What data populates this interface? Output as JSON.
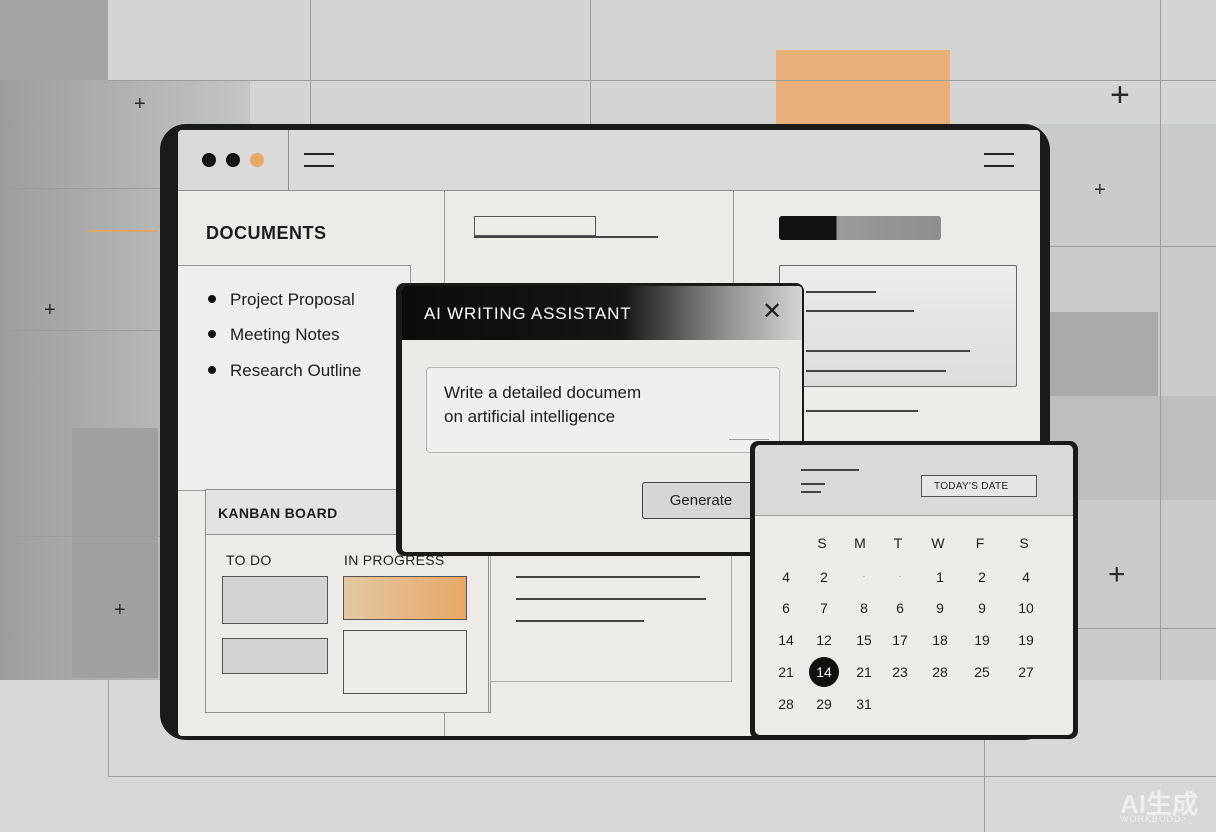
{
  "window": {
    "dots_colors": [
      "#111111",
      "#111111",
      "#e7a866"
    ],
    "accent_color": "#e7b07a"
  },
  "sidebar": {
    "title": "DOCUMENTS",
    "documents": [
      "Project Proposal",
      "Meeting Notes",
      "Research Outline"
    ]
  },
  "kanban": {
    "title": "KANBAN BOARD",
    "columns": [
      "TO DO",
      "IN PROGRESS"
    ]
  },
  "ai_dialog": {
    "title": "AI WRITING ASSISTANT",
    "close_icon": "close-icon",
    "prompt_line_1": "Write a detailed documem",
    "prompt_line_2": "on artificial intelligence",
    "generate_label": "Generate"
  },
  "calendar": {
    "today_label": "TODAY'S DATE",
    "weekdays": [
      "S",
      "M",
      "T",
      "W",
      "F",
      "S"
    ],
    "rows": [
      [
        "4",
        "2",
        "·",
        "·",
        "1",
        "2",
        "4"
      ],
      [
        "6",
        "7",
        "8",
        "6",
        "9",
        "9",
        "10"
      ],
      [
        "14",
        "12",
        "15",
        "17",
        "18",
        "19",
        "19"
      ],
      [
        "21",
        "14",
        "21",
        "23",
        "28",
        "25",
        "27"
      ],
      [
        "28",
        "29",
        "31"
      ]
    ],
    "selected_day": "14"
  },
  "watermark": {
    "text": "AI生成",
    "sub": "WORKBUDD>_"
  }
}
